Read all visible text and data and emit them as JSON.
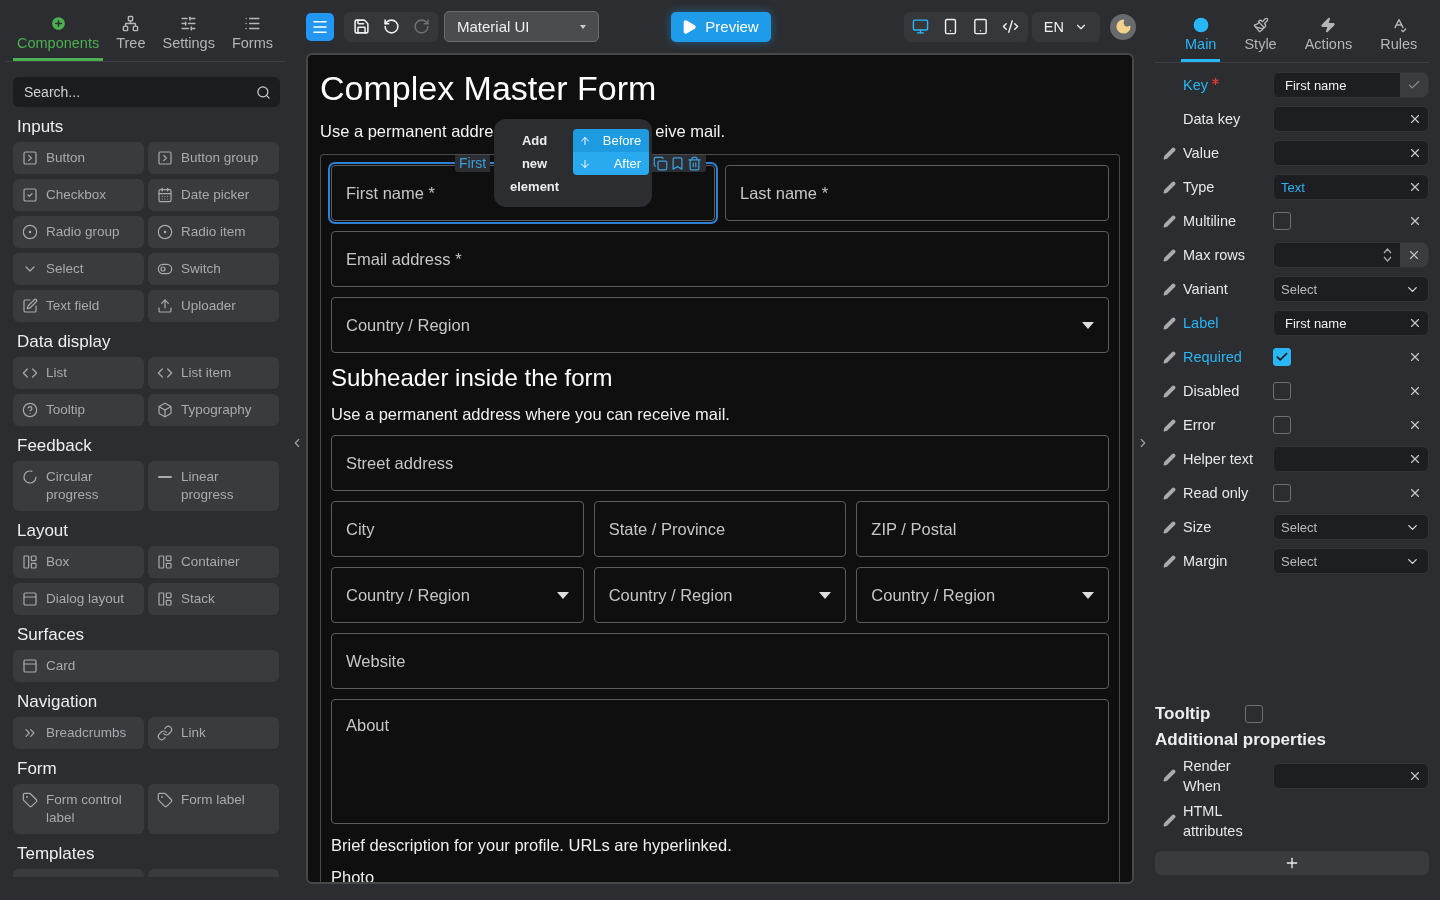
{
  "left_panel": {
    "tabs": [
      {
        "label": "Components",
        "selected": true
      },
      {
        "label": "Tree",
        "selected": false
      },
      {
        "label": "Settings",
        "selected": false
      },
      {
        "label": "Forms",
        "selected": false
      }
    ],
    "search": {
      "placeholder": "Search..."
    },
    "groups": [
      {
        "title": "Inputs",
        "items": [
          "Button",
          "Button group",
          "Checkbox",
          "Date picker",
          "Radio group",
          "Radio item",
          "Select",
          "Switch",
          "Text field",
          "Uploader"
        ]
      },
      {
        "title": "Data display",
        "items": [
          "List",
          "List item",
          "Tooltip",
          "Typography"
        ]
      },
      {
        "title": "Feedback",
        "items": [
          "Circular progress",
          "Linear progress"
        ]
      },
      {
        "title": "Layout",
        "items": [
          "Box",
          "Container",
          "Dialog layout",
          "Stack"
        ]
      },
      {
        "title": "Surfaces",
        "items": [
          "Card"
        ]
      },
      {
        "title": "Navigation",
        "items": [
          "Breadcrumbs",
          "Link"
        ]
      },
      {
        "title": "Form",
        "items": [
          "Form control label",
          "Form label"
        ]
      },
      {
        "title": "Templates"
      }
    ]
  },
  "toolbar": {
    "actions": [
      {
        "kind": "save",
        "disabled": false
      },
      {
        "kind": "undo",
        "disabled": false
      },
      {
        "kind": "redo",
        "disabled": true
      }
    ],
    "framework": "Material UI",
    "preview": "Preview",
    "devices": [
      {
        "kind": "desktop",
        "selected": true
      },
      {
        "kind": "phone",
        "selected": false
      },
      {
        "kind": "tablet",
        "selected": false
      },
      {
        "kind": "code",
        "selected": false
      }
    ],
    "language": "EN"
  },
  "canvas": {
    "title": "Complex Master Form",
    "description_parts": [
      "Use a permanent addre",
      "eive mail."
    ],
    "selection": {
      "tag": "First",
      "popup": {
        "text": "Add new element",
        "options": [
          "Before",
          "After"
        ]
      }
    },
    "form": [
      {
        "kind": "row",
        "fields": [
          {
            "kind": "text",
            "label": "First name *",
            "selected": true
          },
          {
            "kind": "text",
            "label": "Last name *",
            "selected": false
          }
        ]
      },
      {
        "kind": "row",
        "fields": [
          {
            "kind": "text",
            "label": "Email address *",
            "selected": false
          }
        ]
      },
      {
        "kind": "row",
        "fields": [
          {
            "kind": "select",
            "label": "Country / Region",
            "selected": false
          }
        ]
      },
      {
        "kind": "heading",
        "text": "Subheader inside the form"
      },
      {
        "kind": "paragraph",
        "text": "Use a permanent address where you can receive mail."
      },
      {
        "kind": "row",
        "fields": [
          {
            "kind": "text",
            "label": "Street address",
            "selected": false
          }
        ]
      },
      {
        "kind": "row",
        "fields": [
          {
            "kind": "text",
            "label": "City",
            "selected": false
          },
          {
            "kind": "text",
            "label": "State / Province",
            "selected": false
          },
          {
            "kind": "text",
            "label": "ZIP / Postal",
            "selected": false
          }
        ]
      },
      {
        "kind": "row",
        "fields": [
          {
            "kind": "select",
            "label": "Country / Region",
            "selected": false
          },
          {
            "kind": "select",
            "label": "Country / Region",
            "selected": false
          },
          {
            "kind": "select",
            "label": "Country / Region",
            "selected": false
          }
        ]
      },
      {
        "kind": "row",
        "fields": [
          {
            "kind": "text",
            "label": "Website",
            "selected": false
          }
        ]
      },
      {
        "kind": "row",
        "fields": [
          {
            "kind": "textarea",
            "label": "About",
            "selected": false
          }
        ]
      },
      {
        "kind": "paragraph",
        "text": "Brief description for your profile. URLs are hyperlinked."
      },
      {
        "kind": "paragraph",
        "text": "Photo"
      }
    ]
  },
  "right_panel": {
    "tabs": [
      {
        "label": "Main",
        "selected": true
      },
      {
        "label": "Style",
        "selected": false
      },
      {
        "label": "Actions",
        "selected": false
      },
      {
        "label": "Rules",
        "selected": false
      }
    ],
    "properties": [
      {
        "label": "Key",
        "kind": "key",
        "value": "First name",
        "required": true,
        "modified": true,
        "bindable": false
      },
      {
        "label": "Data key",
        "kind": "input",
        "required": false,
        "modified": false,
        "bindable": false
      },
      {
        "label": "Value",
        "kind": "input",
        "required": false,
        "modified": false,
        "bindable": true
      },
      {
        "label": "Type",
        "kind": "autocomplete",
        "value": "Text",
        "required": false,
        "modified": false,
        "bindable": true
      },
      {
        "label": "Multiline",
        "kind": "checkbox",
        "checked": false,
        "required": false,
        "modified": false,
        "bindable": true
      },
      {
        "label": "Max rows",
        "kind": "number",
        "required": false,
        "modified": false,
        "bindable": true
      },
      {
        "label": "Variant",
        "kind": "select",
        "placeholder": "Select",
        "required": false,
        "modified": false,
        "bindable": true
      },
      {
        "label": "Label",
        "kind": "input",
        "value": "First name",
        "required": false,
        "modified": true,
        "bindable": true
      },
      {
        "label": "Required",
        "kind": "checkbox",
        "checked": true,
        "required": false,
        "modified": true,
        "bindable": true
      },
      {
        "label": "Disabled",
        "kind": "checkbox",
        "checked": false,
        "required": false,
        "modified": false,
        "bindable": true
      },
      {
        "label": "Error",
        "kind": "checkbox",
        "checked": false,
        "required": false,
        "modified": false,
        "bindable": true
      },
      {
        "label": "Helper text",
        "kind": "input",
        "required": false,
        "modified": false,
        "bindable": true
      },
      {
        "label": "Read only",
        "kind": "checkbox",
        "checked": false,
        "required": false,
        "modified": false,
        "bindable": true
      },
      {
        "label": "Size",
        "kind": "select",
        "placeholder": "Select",
        "required": false,
        "modified": false,
        "bindable": true
      },
      {
        "label": "Margin",
        "kind": "select",
        "placeholder": "Select",
        "required": false,
        "modified": false,
        "bindable": true
      }
    ],
    "tooltip": {
      "label": "Tooltip",
      "checked": false
    },
    "additional": {
      "title": "Additional properties",
      "items": [
        {
          "label": "Render When",
          "kind": "input",
          "bindable": true
        },
        {
          "label": "HTML attributes",
          "kind": "none",
          "bindable": true
        }
      ]
    }
  }
}
